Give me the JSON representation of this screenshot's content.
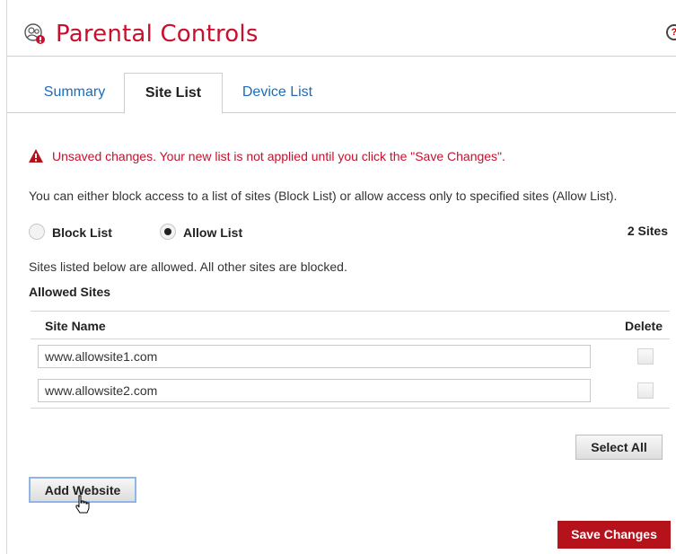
{
  "header": {
    "title": "Parental Controls",
    "help": "?"
  },
  "tabs": [
    {
      "label": "Summary",
      "active": false
    },
    {
      "label": "Site List",
      "active": true
    },
    {
      "label": "Device List",
      "active": false
    }
  ],
  "warning": "Unsaved changes. Your new list is not applied until you click the \"Save Changes\".",
  "description": "You can either block access to a list of sites (Block List) or allow access only to specified sites (Allow List).",
  "mode": {
    "options": [
      {
        "label": "Block List",
        "selected": false
      },
      {
        "label": "Allow List",
        "selected": true
      }
    ],
    "count": "2 Sites"
  },
  "note": "Sites listed below are allowed. All other sites are blocked.",
  "section_title": "Allowed Sites",
  "table": {
    "col_site": "Site Name",
    "col_delete": "Delete",
    "rows": [
      {
        "site": "www.allowsite1.com",
        "delete": false
      },
      {
        "site": "www.allowsite2.com",
        "delete": false
      }
    ]
  },
  "buttons": {
    "select_all": "Select All",
    "add_website": "Add Website",
    "save_changes": "Save Changes"
  },
  "colors": {
    "brand": "#c8102e",
    "link": "#1e6bb8",
    "save": "#b5121b"
  }
}
